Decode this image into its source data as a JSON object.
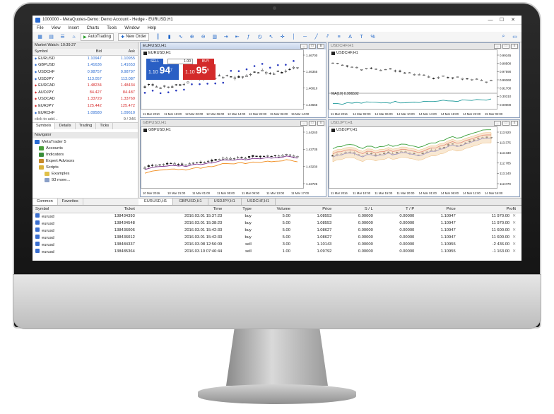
{
  "window": {
    "title": "1000000 - MetaQuotes-Demo: Demo Account - Hedge - EURUSD,H1",
    "min": "—",
    "max": "☐",
    "close": "✕"
  },
  "menu": [
    "File",
    "View",
    "Insert",
    "Charts",
    "Tools",
    "Window",
    "Help"
  ],
  "toolbar": {
    "autotrading": "AutoTrading",
    "new_order": "New Order"
  },
  "market_watch": {
    "header": "Market Watch: 10:39:27",
    "columns": [
      "Symbol",
      "Bid",
      "Ask"
    ],
    "rows": [
      {
        "symbol": "EURUSD",
        "bid": "1.10947",
        "ask": "1.10955",
        "dir": "up"
      },
      {
        "symbol": "GBPUSD",
        "bid": "1.41636",
        "ask": "1.41653",
        "dir": "up"
      },
      {
        "symbol": "USDCHF",
        "bid": "0.98757",
        "ask": "0.98797",
        "dir": "up"
      },
      {
        "symbol": "USDJPY",
        "bid": "113.057",
        "ask": "113.087",
        "dir": "up"
      },
      {
        "symbol": "EURCAD",
        "bid": "1.48234",
        "ask": "1.48434",
        "dir": "dn"
      },
      {
        "symbol": "AUDJPY",
        "bid": "84.427",
        "ask": "84.487",
        "dir": "dn"
      },
      {
        "symbol": "USDCAD",
        "bid": "1.33729",
        "ask": "1.33769",
        "dir": "dn"
      },
      {
        "symbol": "EURJPY",
        "bid": "125.442",
        "ask": "125.472",
        "dir": "dn"
      },
      {
        "symbol": "EURCHF",
        "bid": "1.09580",
        "ask": "1.09610",
        "dir": "up"
      }
    ],
    "add": "click to add...",
    "count": "9 / 346",
    "tabs": [
      "Symbols",
      "Details",
      "Trading",
      "Ticks"
    ]
  },
  "navigator": {
    "header": "Navigator",
    "items": [
      "MetaTrader 5",
      "Accounts",
      "Indicators",
      "Expert Advisors",
      "Scripts",
      "Examples",
      "93 more..."
    ],
    "tabs": [
      "Common",
      "Favorites"
    ]
  },
  "charts": [
    {
      "title": "EURUSD,H1",
      "label": "EURUSD,H1",
      "y_ticks": [
        "1.46700",
        "1.46355",
        "1.46010",
        "1.44665"
      ],
      "x_ticks": [
        "11 Mar 2010",
        "11 Mar 18:00",
        "12 Mar 02:00",
        "12 Mar 06:00",
        "12 Mar 14:00",
        "12 Mar 22:00",
        "15 Mar 06:00",
        "15 Mar 14:00"
      ],
      "trade": {
        "sell": "SELL",
        "buy": "BUY",
        "lot": "1.00",
        "sell_main": "1.10",
        "sell_big": "94",
        "sell_sup": "7",
        "buy_main": "1.10",
        "buy_big": "95",
        "buy_sup": "5"
      }
    },
    {
      "title": "USDCHF,H1",
      "label": "USDCHF,H1",
      "y_ticks": [
        "0.99345",
        "0.98500",
        "0.97590",
        "0.99360",
        "0.91700",
        "0.30310",
        "0.00000"
      ],
      "x_ticks": [
        "11 Mar 2016",
        "14 Mar 02:00",
        "14 Mar 06:00",
        "14 Mar 10:00",
        "14 Mar 14:00",
        "14 Mar 18:00",
        "14 Mar 22:00",
        "15 Mar 02:00"
      ],
      "indicator": "MA(10) 0.996592",
      "tags": [
        "1.30",
        "1.30",
        "0.00"
      ]
    },
    {
      "title": "GBPUSD,H1",
      "label": "GBPUSD,H1",
      "y_ticks": [
        "1.44240",
        "1.43735",
        "1.43230",
        "1.42725"
      ],
      "x_ticks": [
        "10 Mar 2016",
        "10 Mar 21:00",
        "11 Mar 01:00",
        "11 Mar 05:00",
        "11 Mar 09:00",
        "11 Mar 13:00",
        "11 Mar 17:00"
      ]
    },
    {
      "title": "USDJPY,H1",
      "label": "USDJPY,H1",
      "y_ticks": [
        "113.920",
        "113.375",
        "113.330",
        "112.785",
        "113.240",
        "112.070"
      ],
      "x_ticks": [
        "11 Mar 2016",
        "11 Mar 10:00",
        "11 Mar 15:00",
        "11 Mar 20:00",
        "14 Mar 01:00",
        "14 Mar 06:00",
        "14 Mar 11:00",
        "14 Mar 16:00"
      ]
    }
  ],
  "chart_tabs": [
    "EURUSD,H1",
    "GBPUSD,H1",
    "USDJPY,H1",
    "USDCHF,H1"
  ],
  "terminal": {
    "columns": [
      "Symbol",
      "Ticket",
      "Time",
      "Type",
      "Volume",
      "Price",
      "S / L",
      "T / P",
      "Price",
      "Profit"
    ],
    "rows": [
      [
        "eurusd",
        "138434393",
        "2016.03.01 15:37:23",
        "buy",
        "5.00",
        "1.08553",
        "0.00000",
        "0.00000",
        "1.10947",
        "11 970.00"
      ],
      [
        "eurusd",
        "138434548",
        "2016.03.01 15:38:23",
        "buy",
        "5.00",
        "1.08553",
        "0.00000",
        "0.00000",
        "1.10947",
        "11 970.00"
      ],
      [
        "eurusd",
        "138436006",
        "2016.03.01 15:42:33",
        "buy",
        "5.00",
        "1.08627",
        "0.00000",
        "0.00000",
        "1.10947",
        "11 600.00"
      ],
      [
        "eurusd",
        "138436012",
        "2016.03.01 15:42:33",
        "buy",
        "5.00",
        "1.08627",
        "0.00000",
        "0.00000",
        "1.10947",
        "11 600.00"
      ],
      [
        "eurusd",
        "138484337",
        "2016.03.08 12:56:09",
        "sell",
        "3.00",
        "1.10143",
        "0.00000",
        "0.00000",
        "1.10955",
        "-2 436.00"
      ],
      [
        "eurusd",
        "138485364",
        "2016.03.10 07:46:44",
        "sell",
        "1.00",
        "1.09792",
        "0.00000",
        "0.00000",
        "1.10955",
        "-1 163.00"
      ]
    ]
  },
  "colors": {
    "up": "#2a6bd1",
    "down": "#d62a2a",
    "sell": "#2a5fc4",
    "buy": "#d32a2a"
  }
}
